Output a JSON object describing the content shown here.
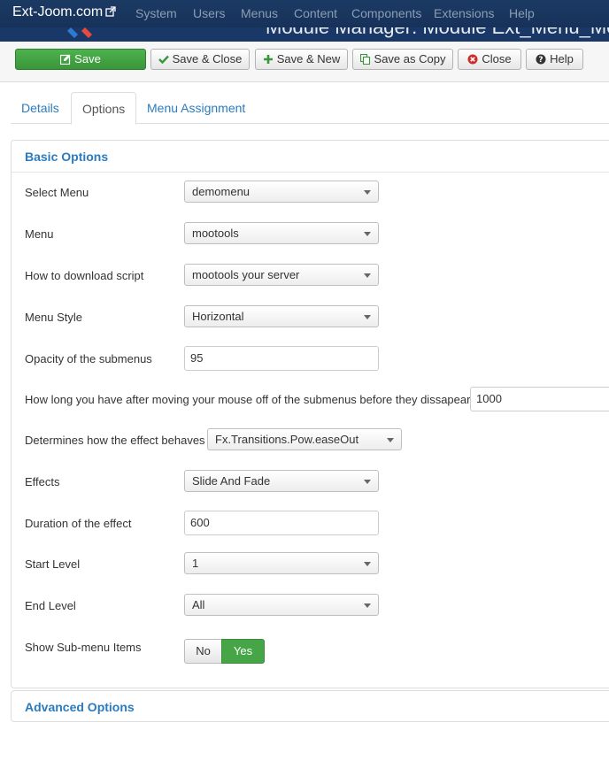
{
  "navbar": {
    "brand": "Ext-Joom.com",
    "menu": [
      "System",
      "Users",
      "Menus",
      "Content",
      "Components",
      "Extensions",
      "Help"
    ]
  },
  "subhead": {
    "title": "Module Manager: Module Ext_Menu_Mootools"
  },
  "toolbar": {
    "save": "Save",
    "save_close": "Save & Close",
    "save_new": "Save & New",
    "save_copy": "Save as Copy",
    "close": "Close",
    "help": "Help"
  },
  "tabs": [
    "Details",
    "Options",
    "Menu Assignment"
  ],
  "basic": {
    "title": "Basic Options",
    "select_menu": {
      "label": "Select Menu",
      "value": "demomenu"
    },
    "menu": {
      "label": "Menu",
      "value": "mootools"
    },
    "download": {
      "label": "How to download script",
      "value": "mootools your server"
    },
    "style": {
      "label": "Menu Style",
      "value": "Horizontal"
    },
    "opacity": {
      "label": "Opacity of the submenus",
      "value": "95"
    },
    "delay": {
      "label": "How long you have after moving your mouse off of the submenus before they dissapear",
      "value": "1000"
    },
    "transition": {
      "label": "Determines how the effect behaves",
      "value": "Fx.Transitions.Pow.easeOut"
    },
    "effects": {
      "label": "Effects",
      "value": "Slide And Fade"
    },
    "duration": {
      "label": "Duration of the effect",
      "value": "600"
    },
    "start_level": {
      "label": "Start Level",
      "value": "1"
    },
    "end_level": {
      "label": "End Level",
      "value": "All"
    },
    "show_sub": {
      "label": "Show Sub-menu Items",
      "no": "No",
      "yes": "Yes",
      "selected": "Yes"
    }
  },
  "advanced": {
    "title": "Advanced Options"
  },
  "colors": {
    "accent": "#2a7bbf",
    "success": "#46a546",
    "navbar": "#1b3a63"
  }
}
